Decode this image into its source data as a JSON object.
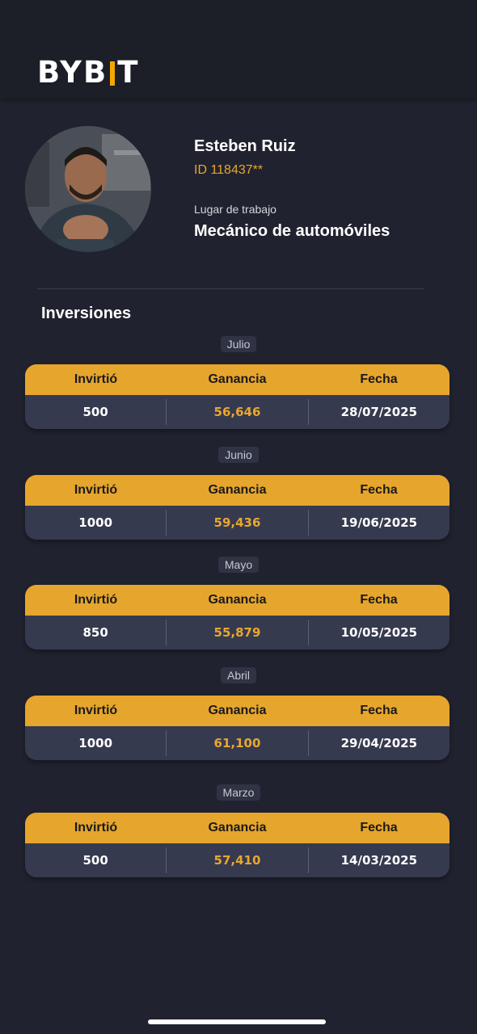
{
  "brand": {
    "left": "BYB",
    "right": "T"
  },
  "profile": {
    "name": "Esteben Ruiz",
    "id": "ID 118437**",
    "work_label": "Lugar de trabajo",
    "work_value": "Mecánico de automóviles"
  },
  "section_title": "Inversiones",
  "table_headers": {
    "invested": "Invirtió",
    "profit": "Ganancia",
    "date": "Fecha"
  },
  "investments": [
    {
      "month": "Julio",
      "invested": "500",
      "profit": "56,646",
      "date": "28/07/2025"
    },
    {
      "month": "Junio",
      "invested": "1000",
      "profit": "59,436",
      "date": "19/06/2025"
    },
    {
      "month": "Mayo",
      "invested": "850",
      "profit": "55,879",
      "date": "10/05/2025"
    },
    {
      "month": "Abril",
      "invested": "1000",
      "profit": "61,100",
      "date": "29/04/2025"
    },
    {
      "month": "Marzo",
      "invested": "500",
      "profit": "57,410",
      "date": "14/03/2025"
    }
  ],
  "colors": {
    "accent": "#e6a52c",
    "background": "#20222f",
    "card": "#363a4f"
  }
}
